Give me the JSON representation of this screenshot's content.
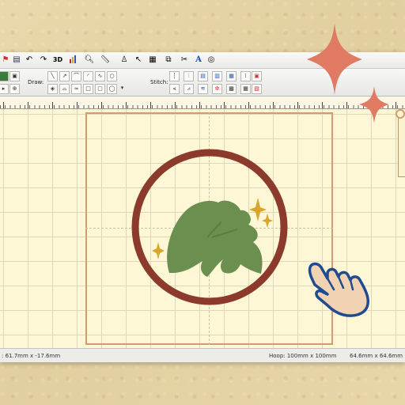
{
  "toolbar_draw_label": "Draw:",
  "toolbar_stitch_label": "Stitch:",
  "toolbar_3d_label": "3D",
  "toolbar_text_tool": "A",
  "status": {
    "cursor": ": 61.7mm x -17.6mm",
    "hoop": "Hoop: 100mm x 100mm",
    "size": "64.6mm x 64.6mm"
  },
  "colors": {
    "ring": "#8c3a2c",
    "leaf": "#6b8f4e",
    "sparkle_gold": "#d9a52b",
    "deco_star": "#e07a63",
    "hand_fill": "#f1d2b3",
    "hand_outline": "#1f4b8f"
  },
  "icons": {
    "deco": [
      "sparkle-star-large",
      "sparkle-star-small"
    ],
    "cursor": "pointing-hand-icon"
  }
}
